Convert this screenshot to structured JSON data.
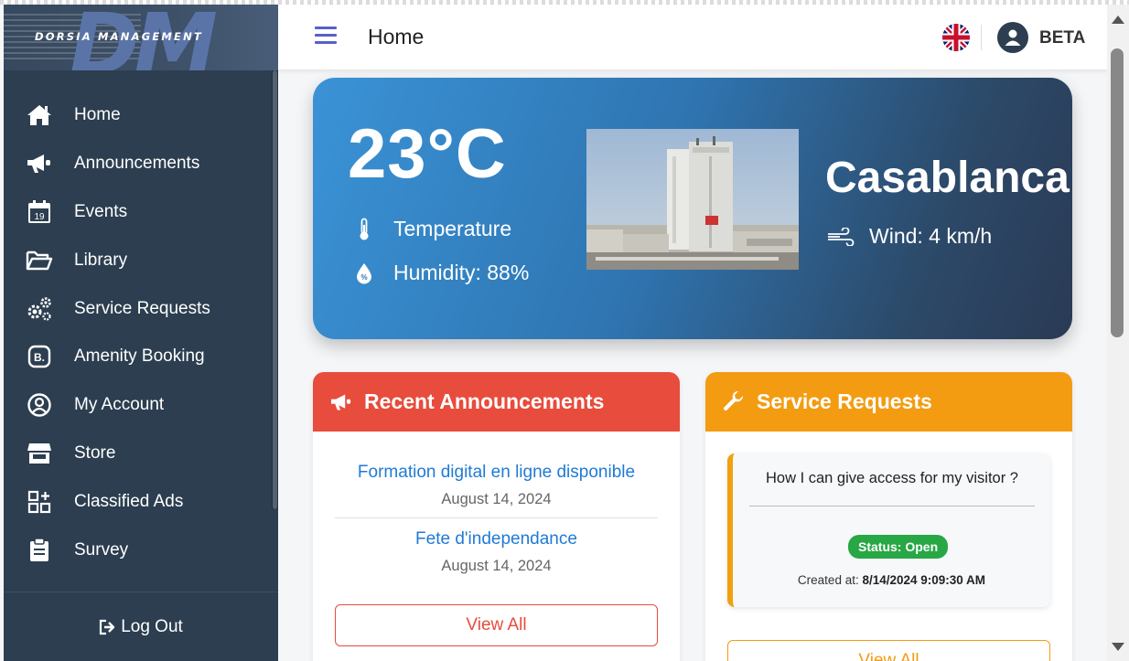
{
  "brand": {
    "logo_monogram": "DM",
    "logo_text": "DORSIA MANAGEMENT"
  },
  "sidebar": {
    "items": [
      {
        "label": "Home",
        "icon": "home-icon"
      },
      {
        "label": "Announcements",
        "icon": "megaphone-icon"
      },
      {
        "label": "Events",
        "icon": "calendar-icon",
        "icon_text": "19"
      },
      {
        "label": "Library",
        "icon": "folder-open-icon"
      },
      {
        "label": "Service Requests",
        "icon": "gears-icon"
      },
      {
        "label": "Amenity Booking",
        "icon": "booking-icon",
        "icon_text": "B."
      },
      {
        "label": "My Account",
        "icon": "user-circle-icon"
      },
      {
        "label": "Store",
        "icon": "store-icon"
      },
      {
        "label": "Classified Ads",
        "icon": "grid-plus-icon"
      },
      {
        "label": "Survey",
        "icon": "clipboard-icon"
      }
    ],
    "logout_label": "Log Out"
  },
  "header": {
    "title": "Home",
    "language_flag": "uk-flag-icon",
    "user_name": "BETA"
  },
  "weather": {
    "temperature": "23°C",
    "temperature_label": "Temperature",
    "humidity": "Humidity: 88%",
    "city": "Casablanca",
    "wind": "Wind: 4 km/h"
  },
  "announcements": {
    "title": "Recent Announcements",
    "items": [
      {
        "title": "Formation digital en ligne disponible",
        "date": "August 14, 2024"
      },
      {
        "title": "Fete d'independance",
        "date": "August 14, 2024"
      }
    ],
    "view_all": "View All"
  },
  "service_requests": {
    "title": "Service Requests",
    "items": [
      {
        "title": "How I can give access for my visitor ?",
        "status": "Status: Open",
        "created_label": "Created at:",
        "created_at": "8/14/2024 9:09:30 AM"
      }
    ],
    "view_all": "View All"
  },
  "colors": {
    "sidebar_bg": "#2c3e50",
    "announcements_header": "#e74c3c",
    "service_requests_header": "#f39c12",
    "status_open": "#28a745",
    "link": "#1f7ad6",
    "accent_menu": "#5a5fc9"
  }
}
